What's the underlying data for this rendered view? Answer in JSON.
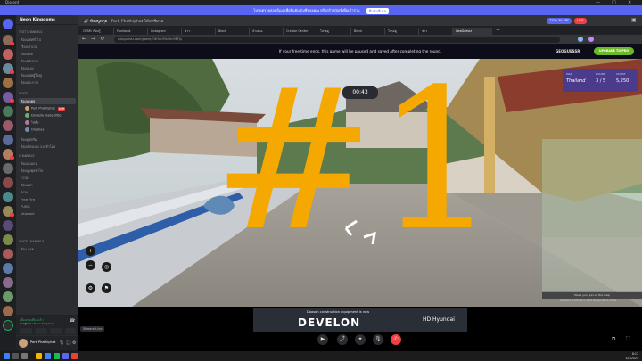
{
  "window": {
    "app_title": "Discord",
    "controls": [
      "—",
      "□",
      "✕"
    ]
  },
  "notice": {
    "text": "โปรดตรวจสอบอีเมลเพื่อยืนยันบัญชีของคุณ หรือสร้างบัญชีเพื่อเข้าร่วม",
    "button": "ยืนยันอีเมล"
  },
  "server": {
    "name": "Neon Kingdoms"
  },
  "channel_list": {
    "categories": [
      "TEXT CHANNELS",
      "VOICE",
      "CHANNELS",
      "VOICE CHANNELS"
    ],
    "text_channels": [
      "ห้องแชททั่วไป",
      "เรื่องเล่าเกม",
      "ห้องบอท",
      "ห้องคลิปเกม",
      "ห้องเพลง",
      "ห้องแชทผู้ใหญ่",
      "ห้องประกาศ"
    ],
    "voice_selected": "ห้องพูดคุย",
    "voice_users": [
      {
        "name": "Park Phathiphat",
        "badge": "LIVE"
      },
      {
        "name": "Daniella made ditto"
      },
      {
        "name": "ไข่ต้ม"
      },
      {
        "name": "Oreohex"
      }
    ],
    "more_channels": [
      "ห้องดูสตรีม",
      "ห้องเปิดเพลง 24 ชั่วโมง",
      "ห้องเล่นเกม",
      "ห้องพูดคุยทั่วไป",
      "COD",
      "ห้องแยก",
      "ROV",
      "Free Fire",
      "PUBG",
      "Valorant",
      "ห้อง AFK"
    ]
  },
  "voice_status": {
    "status": "เชื่อมต่อเสียงแล้ว",
    "location": "ห้องพูดคุย / Neon Kingdoms"
  },
  "user_panel": {
    "username": "Park Phathiphat"
  },
  "stage": {
    "title": "ห้องพูดคุย",
    "subtitle": "Park Phathiphat ได้สตรีมจอ",
    "quality": "720p 30 FPS",
    "live": "LIVE"
  },
  "browser": {
    "tabs": [
      "CUSM เรียนรู้",
      "Facebook",
      "Instagram",
      "ข่าว",
      "Blank",
      "นำเสนอ",
      "Creator Center",
      "โปรดดู",
      "Blank",
      "โปรดดู",
      "ข่าว",
      "GeoGuessr"
    ],
    "url": "geoguessr.com/game/7dHdc59dRm9EFJs"
  },
  "game": {
    "notice": "If your free time ends, this game will be paused and saved after completing the round.",
    "brand": "GEOGUESSR",
    "upgrade": "UPGRADE TO PRO",
    "timer": "00:43",
    "map_name": "Thailand",
    "round_label": "ROUND",
    "round": "3 / 5",
    "score_label": "SCORE",
    "score": "5,250",
    "overlay_text": "#1",
    "map_hint": "Place your pin on the map",
    "copyright": "Keyboard shortcuts  © 2024 Google  Terms of Use",
    "stream_tag": "Stream Live"
  },
  "ad": {
    "headline": "Doosan construction equipment is now",
    "brand": "DEVELON",
    "partner": "HD Hyundai"
  },
  "taskbar": {
    "time": "8:11",
    "date": "4/3/2024"
  }
}
